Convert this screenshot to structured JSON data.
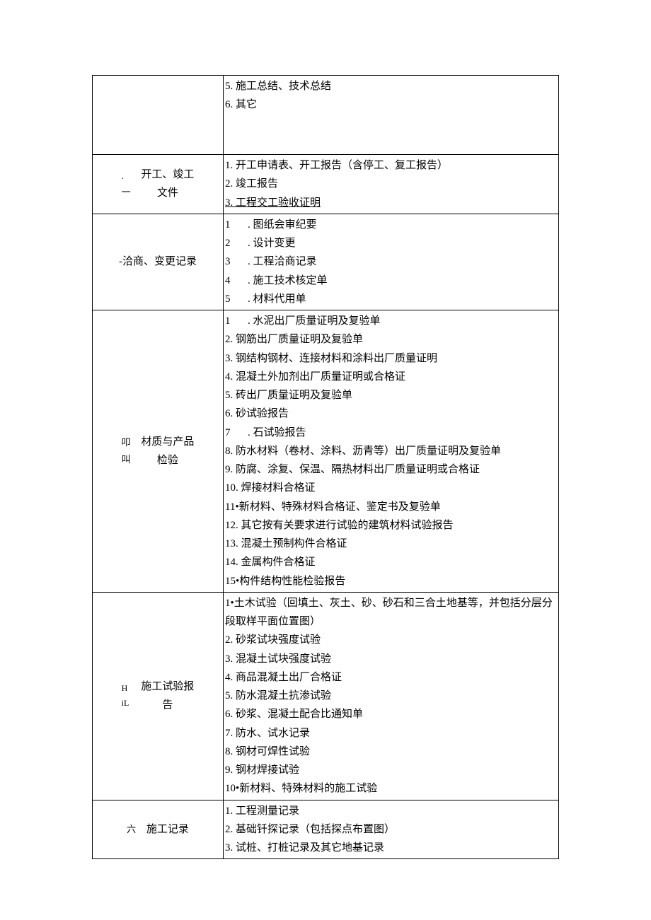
{
  "rows": [
    {
      "index_lines": [],
      "label": "",
      "items": [
        {
          "text": "5. 施工总结、技术总结"
        },
        {
          "text": "6. 其它"
        }
      ],
      "extra_blank": true
    },
    {
      "index_lines": [
        ".",
        "一"
      ],
      "label": "开工、竣工文件",
      "label_br": "开工、竣工<br>文件",
      "items": [
        {
          "text": "1. 开工申请表、开工报告（含停工、复工报告）"
        },
        {
          "text": "2. 竣工报告"
        },
        {
          "text": "3. 工程交工验收证明",
          "underline": true
        }
      ]
    },
    {
      "index_lines": [],
      "label": "-洽商、变更记录",
      "left_plain": true,
      "items_numbered": [
        {
          "num": "1",
          "text": ". 图纸会审纪要"
        },
        {
          "num": "2",
          "text": ". 设计变更"
        },
        {
          "num": "3",
          "text": ". 工程洽商记录"
        },
        {
          "num": "4",
          "text": ". 施工技术核定单"
        },
        {
          "num": "5",
          "text": ". 材料代用单"
        }
      ]
    },
    {
      "index_lines": [
        "叩",
        "叫"
      ],
      "label_br": "材质与产品<br>检验",
      "items": [
        {
          "num": "1",
          "numbered": true,
          "text": ". 水泥出厂质量证明及复验单"
        },
        {
          "text": "2. 钢筋出厂质量证明及复验单"
        },
        {
          "text": "3. 钢结构钢材、连接材料和涂料出厂质量证明"
        },
        {
          "text": "4. 混凝土外加剂出厂质量证明或合格证"
        },
        {
          "text": "5. 砖出厂质量证明及复验单"
        },
        {
          "text": "6. 砂试验报告"
        },
        {
          "num": "7",
          "numbered": true,
          "text": ". 石试验报告"
        },
        {
          "text": "8. 防水材料（卷材、涂料、沥青等）出厂质量证明及复验单"
        },
        {
          "text": "9. 防腐、涂复、保温、隔热材料出厂质量证明或合格证"
        },
        {
          "text": "10. 焊接材料合格证"
        },
        {
          "text": "11•新材料、特殊材料合格证、鉴定书及复验单"
        },
        {
          "text": "12. 其它按有关要求进行试验的建筑材料试验报告"
        },
        {
          "text": "13. 混凝土预制构件合格证"
        },
        {
          "text": "14. 金属构件合格证"
        },
        {
          "text": "15•构件结构性能检验报告"
        }
      ]
    },
    {
      "index_lines": [
        "H",
        "iL"
      ],
      "idx_small": true,
      "label_br": "施工试验报<br>告",
      "items": [
        {
          "text": "1•土木试验（回填土、灰土、砂、砂石和三合土地基等，并包括分层分段取样平面位置图）"
        },
        {
          "text": "2. 砂浆试块强度试验"
        },
        {
          "text": "3. 混凝土试块强度试验"
        },
        {
          "text": "4. 商品混凝土出厂合格证"
        },
        {
          "text": "5. 防水混凝土抗渗试验"
        },
        {
          "text": "6. 砂浆、混凝土配合比通知单"
        },
        {
          "text": "7. 防水、试水记录"
        },
        {
          "text": "8. 钢材可焊性试验"
        },
        {
          "text": "9. 钢材焊接试验"
        },
        {
          "text": "10•新材料、特殊材料的施工试验"
        }
      ]
    },
    {
      "index_lines": [
        "六"
      ],
      "label": "施工记录",
      "items": [
        {
          "text": "1. 工程测量记录"
        },
        {
          "text": "2. 基础钎探记录（包括探点布置图）"
        },
        {
          "text": "3. 试桩、打桩记录及其它地基记录"
        }
      ]
    }
  ]
}
